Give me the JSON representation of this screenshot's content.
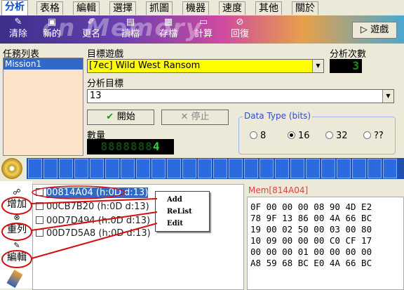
{
  "tabs": [
    "分析",
    "表格",
    "編輯",
    "選擇",
    "抓圖",
    "機器",
    "速度",
    "其他",
    "關於"
  ],
  "toolbar": {
    "watermark": "cn Memory",
    "buttons": [
      {
        "icon": "clear-icon",
        "label": "清除"
      },
      {
        "icon": "new-icon",
        "label": "新的"
      },
      {
        "icon": "rename-icon",
        "label": "更名"
      },
      {
        "icon": "load-icon",
        "label": "讀檔"
      },
      {
        "icon": "save-icon",
        "label": "存檔"
      },
      {
        "icon": "calc-icon",
        "label": "計算"
      },
      {
        "icon": "restore-icon",
        "label": "回復"
      }
    ],
    "game_button": "遊戲"
  },
  "left": {
    "task_list_label": "任務列表",
    "task_items": [
      "Mission1"
    ]
  },
  "form": {
    "target_game_label": "目標遊戲",
    "target_game_value": "[7ec] Wild West Ransom",
    "analysis_count_label": "分析次數",
    "analysis_count_value": "3",
    "analysis_target_label": "分析目標",
    "analysis_target_value": "13",
    "start_label": "開始",
    "stop_label": "停止",
    "quantity_label": "數量",
    "quantity_value": "4"
  },
  "data_type": {
    "legend": "Data Type (bits)",
    "options": [
      "8",
      "16",
      "32",
      "??"
    ],
    "selected": "16"
  },
  "side_buttons": [
    "增加",
    "重列",
    "編輯"
  ],
  "results": [
    "00814A04 (h:0D d:13)",
    "00CB7B20 (h:0D d:13)",
    "00D7D494 (h:0D d:13)",
    "00D7D5A8 (h:0D d:13)"
  ],
  "context_menu": [
    "Add",
    "ReList",
    "Edit"
  ],
  "memory": {
    "title": "Mem[814A04]",
    "rows": [
      "0F 00 00 00 08 90 4D E2",
      "78 9F 13 86 00 4A 66 BC",
      "19 00 02 50 00 03 00 80",
      "10 09 00 00 00 C0 CF 17",
      "00 00 00 01 00 00 00 00",
      "A8 59 68 BC E0 4A 66 BC"
    ]
  },
  "colors": {
    "accent": "#0050d0",
    "game_select_bg": "#ffff00",
    "led_green": "#1d8a1d",
    "annotation_red": "#d01010"
  }
}
